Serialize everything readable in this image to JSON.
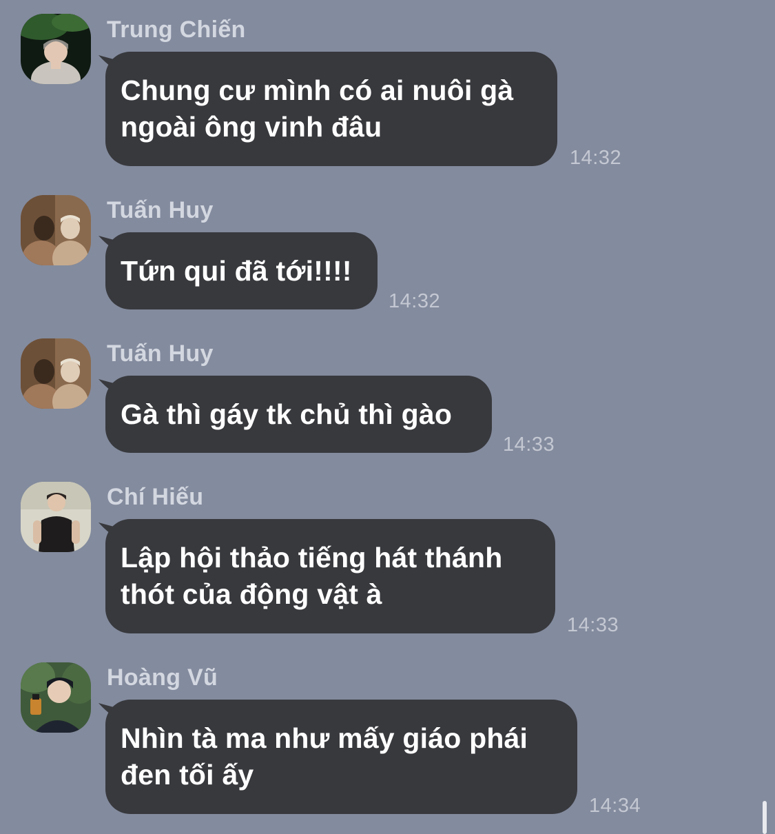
{
  "messages": [
    {
      "sender": "Trung Chiến",
      "avatar_icon": "profile-photo-icon",
      "lines": [
        "Chung cư mình có ai nuôi gà",
        "ngoài ông vinh đâu"
      ],
      "time": "14:32"
    },
    {
      "sender": "Tuấn Huy",
      "avatar_icon": "profile-photo-icon",
      "lines": [
        "Tứn qui đã tới!!!!"
      ],
      "time": "14:32"
    },
    {
      "sender": "Tuấn Huy",
      "avatar_icon": "profile-photo-icon",
      "lines": [
        "Gà thì gáy tk chủ thì gào"
      ],
      "time": "14:33"
    },
    {
      "sender": "Chí Hiếu",
      "avatar_icon": "profile-photo-icon",
      "lines": [
        "Lập hội thảo tiếng hát thánh",
        "thót của động vật à"
      ],
      "time": "14:33"
    },
    {
      "sender": "Hoàng Vũ",
      "avatar_icon": "profile-photo-icon",
      "lines": [
        "Nhìn tà ma như mấy giáo phái",
        "đen tối ấy"
      ],
      "time": "14:34"
    }
  ],
  "colors": {
    "background": "#838b9e",
    "bubble": "#38393d",
    "bubble_text": "#ffffff",
    "sender_name": "#d3d7e0",
    "timestamp": "#c4c8d2"
  }
}
